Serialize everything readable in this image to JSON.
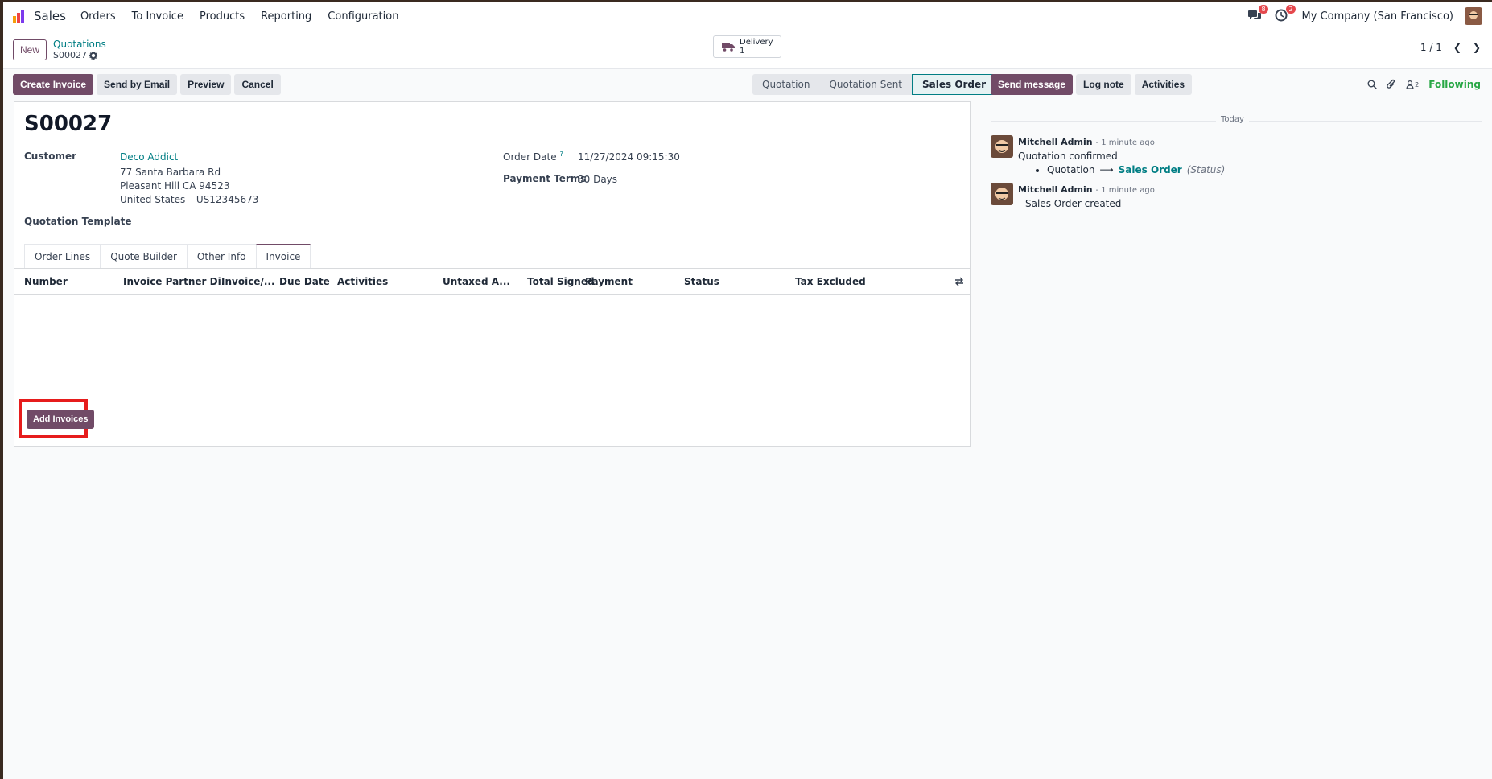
{
  "navbar": {
    "app_name": "Sales",
    "menu": [
      "Orders",
      "To Invoice",
      "Products",
      "Reporting",
      "Configuration"
    ],
    "messages_count": "8",
    "activities_count": "2",
    "company": "My Company (San Francisco)"
  },
  "control": {
    "new_label": "New",
    "breadcrumb": "Quotations",
    "current_record": "S00027",
    "delivery_label": "Delivery",
    "delivery_count": "1",
    "pager": "1 / 1"
  },
  "actions": {
    "create_invoice": "Create Invoice",
    "send_by_email": "Send by Email",
    "preview": "Preview",
    "cancel": "Cancel"
  },
  "status_stages": [
    "Quotation",
    "Quotation Sent",
    "Sales Order"
  ],
  "status_active": "Sales Order",
  "form": {
    "reference": "S00027",
    "customer_label": "Customer",
    "customer_name": "Deco Addict",
    "address_1": "77 Santa Barbara Rd",
    "address_2": "Pleasant Hill CA 94523",
    "address_3": "United States – US12345673",
    "order_date_label": "Order Date",
    "order_date_help": "?",
    "order_date": "11/27/2024 09:15:30",
    "payment_terms_label": "Payment Terms",
    "payment_terms": "30 Days",
    "quotation_template_label": "Quotation Template"
  },
  "tabs": [
    "Order Lines",
    "Quote Builder",
    "Other Info",
    "Invoice"
  ],
  "active_tab": "Invoice",
  "invoice_table": {
    "columns": [
      "Number",
      "Invoice Partner Di...",
      "Invoice/...",
      "Due Date",
      "Activities",
      "Untaxed A...",
      "Total Signed",
      "Payment",
      "Status",
      "Tax Excluded"
    ],
    "rows": []
  },
  "add_invoices_label": "Add Invoices",
  "chatter": {
    "send_message": "Send message",
    "log_note": "Log note",
    "activities": "Activities",
    "followers_count": "2",
    "following": "Following",
    "today_label": "Today",
    "messages": [
      {
        "author": "Mitchell Admin",
        "time": "- 1 minute ago",
        "text": "Quotation confirmed",
        "tracking_old": "Quotation",
        "tracking_new": "Sales Order",
        "tracking_field": "(Status)"
      },
      {
        "author": "Mitchell Admin",
        "time": "- 1 minute ago",
        "text": "Sales Order created"
      }
    ]
  },
  "colors": {
    "primary": "#714b67",
    "link": "#017e84",
    "highlight": "#e61c1c",
    "following": "#28a745"
  }
}
